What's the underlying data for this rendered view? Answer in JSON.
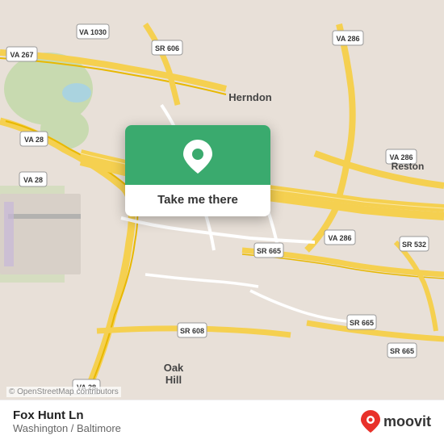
{
  "map": {
    "attribution": "© OpenStreetMap contributors",
    "center_location": "Fox Hunt Ln",
    "region": "Washington / Baltimore"
  },
  "popup": {
    "button_label": "Take me there"
  },
  "bottom_bar": {
    "location_name": "Fox Hunt Ln",
    "region_name": "Washington / Baltimore",
    "logo_text": "moovit"
  },
  "colors": {
    "green": "#3aaa6e",
    "road_yellow": "#f5d87a",
    "road_white": "#ffffff",
    "map_bg": "#e8e0d8",
    "map_green": "#c8dbb0",
    "map_blue": "#aad3df"
  }
}
